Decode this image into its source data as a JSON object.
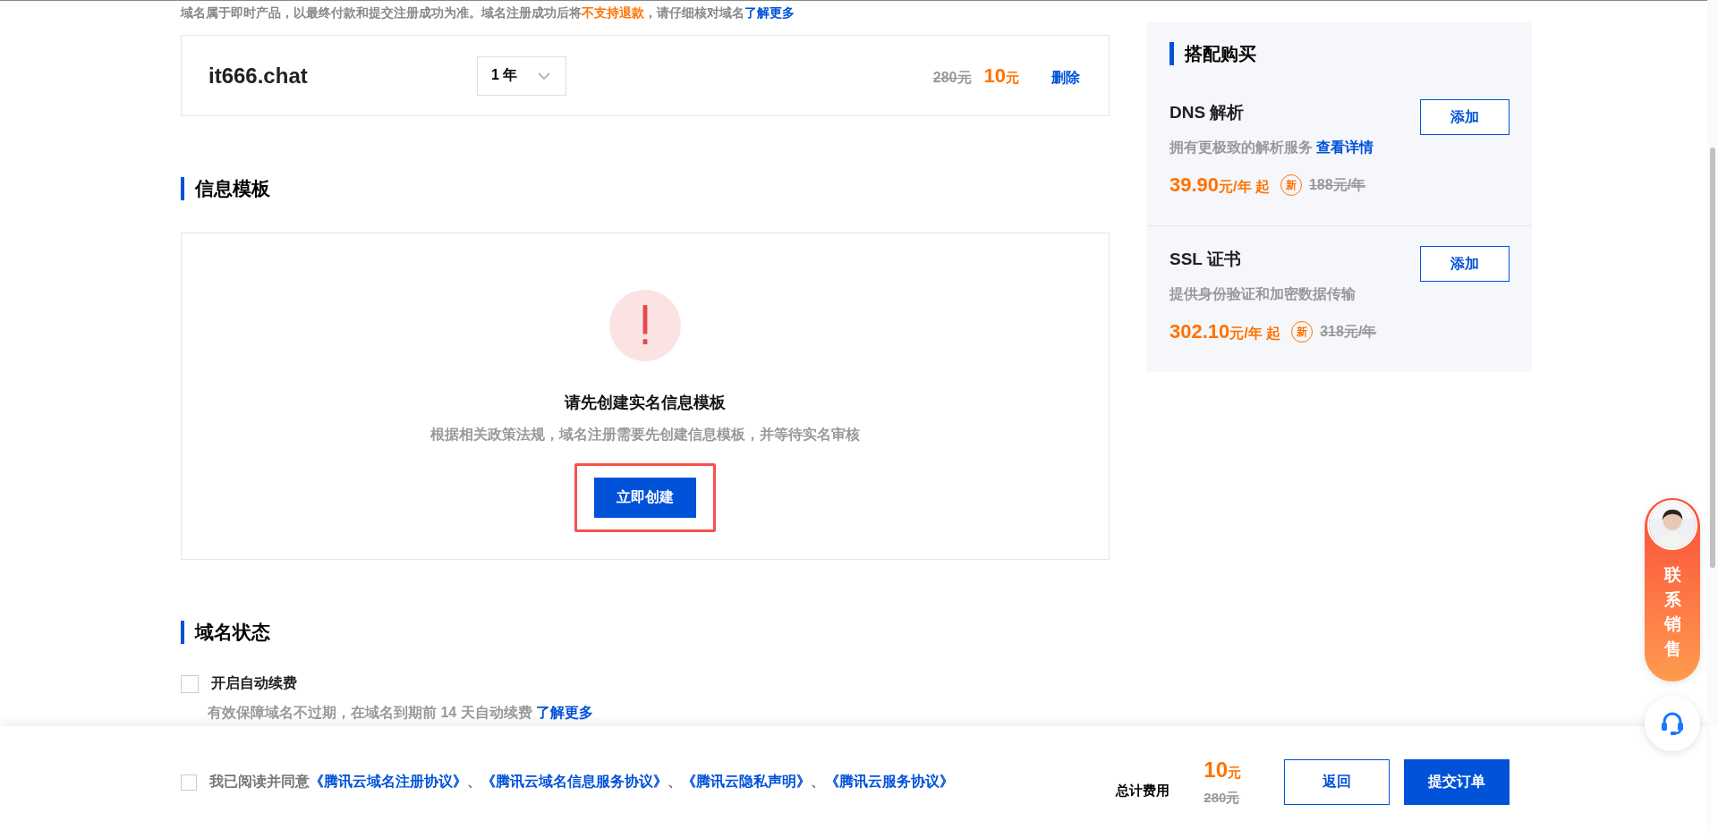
{
  "notice": [
    {
      "kind": "text",
      "text": "域名属于即时产品，以最终付款和提交注册成功为准。域名注册成功后将"
    },
    {
      "kind": "warning",
      "text": "不支持退款"
    },
    {
      "kind": "text",
      "text": "，请仔细核对域名"
    },
    {
      "kind": "link",
      "text": "了解更多"
    }
  ],
  "domain_item": {
    "name": "it666.chat",
    "period": "1 年",
    "original_price": "280元",
    "price": "10",
    "unit": "元",
    "delete": "删除"
  },
  "template_section": {
    "title": "信息模板",
    "empty_state": {
      "title": "请先创建实名信息模板",
      "description": "根据相关政策法规，域名注册需要先创建信息模板，并等待实名审核",
      "button": "立即创建",
      "highlighted": true
    }
  },
  "status_section": {
    "title": "域名状态",
    "auto_renew": {
      "label": "开启自动续费",
      "checked": false
    },
    "hint": "有效保障域名不过期，在域名到期前 14 天自动续费",
    "hint_link": "了解更多"
  },
  "bundle": {
    "title": "搭配购买",
    "products": [
      {
        "name": "DNS 解析",
        "button": "添加",
        "description": "拥有更极致的解析服务",
        "link": "查看详情",
        "price": "39.90",
        "unit": "元/年 起",
        "badge": "新",
        "original_price": "188元/年"
      },
      {
        "name": "SSL 证书",
        "button": "添加",
        "description": "提供身份验证和加密数据传输",
        "price": "302.10",
        "unit": "元/年 起",
        "badge": "新",
        "original_price": "318元/年"
      }
    ]
  },
  "footer": {
    "agree": {
      "label": "我已阅读并同意",
      "checked": false
    },
    "agreements": [
      {
        "kind": "link",
        "text": "《腾讯云域名注册协议》"
      },
      {
        "kind": "separator",
        "text": "、"
      },
      {
        "kind": "link",
        "text": "《腾讯云域名信息服务协议》"
      },
      {
        "kind": "separator",
        "text": "、"
      },
      {
        "kind": "link",
        "text": "《腾讯云隐私声明》"
      },
      {
        "kind": "separator",
        "text": "、"
      },
      {
        "kind": "link",
        "text": "《腾讯云服务协议》"
      }
    ],
    "total_label": "总计费用",
    "total": "10",
    "total_unit": "元",
    "total_original": "280元",
    "buttons": [
      {
        "label": "返回",
        "kind": "secondary"
      },
      {
        "label": "提交订单",
        "kind": "primary"
      }
    ]
  },
  "contact": {
    "label": "联系销售"
  }
}
